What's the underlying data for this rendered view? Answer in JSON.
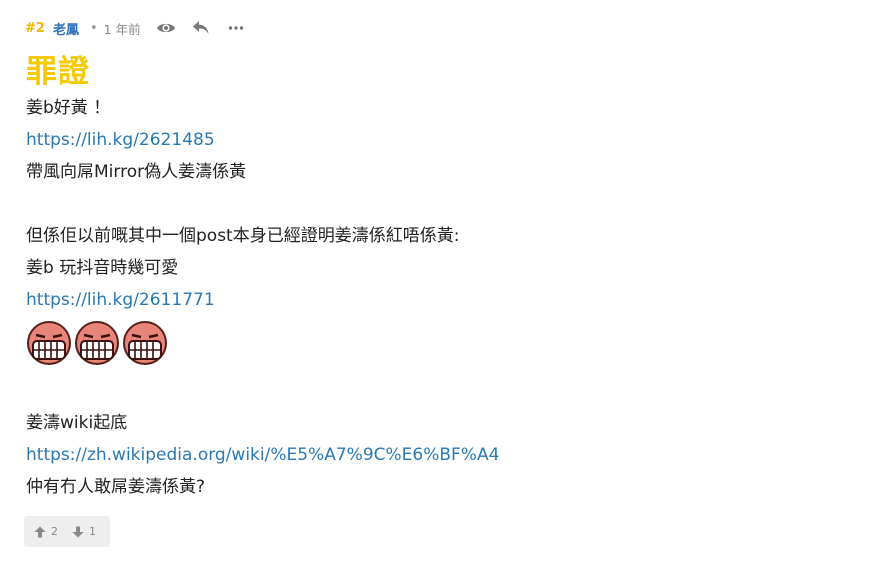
{
  "post": {
    "floor": "#2",
    "author": "老鳳",
    "separator": "•",
    "time": "1 年前",
    "title": "罪證",
    "icons": {
      "view": "eye-icon",
      "reply": "reply-icon",
      "more": "more-icon",
      "upvote": "upvote-icon",
      "downvote": "downvote-icon",
      "emoji": "laughing-face-icon"
    },
    "lines": {
      "l1": "姜b好黃 ！",
      "l2": "https://lih.kg/2621485",
      "l3": "帶風向屌Mirror偽人姜濤係黃",
      "l4": "但係佢以前嘅其中一個post本身已經證明姜濤係紅唔係黃:",
      "l5": "姜b 玩抖音時幾可愛",
      "l6": "https://lih.kg/2611771",
      "l7": "姜濤wiki起底",
      "l8": "https://zh.wikipedia.org/wiki/%E5%A7%9C%E6%BF%A4",
      "l9": "仲有冇人敢屌姜濤係黃?"
    },
    "votes": {
      "up": "2",
      "down": "1"
    }
  },
  "colors": {
    "floor": "#f5b400",
    "author": "#2f6fb8",
    "title": "#f5c800",
    "link": "#2a79b3",
    "muted": "#8a8a8a"
  }
}
